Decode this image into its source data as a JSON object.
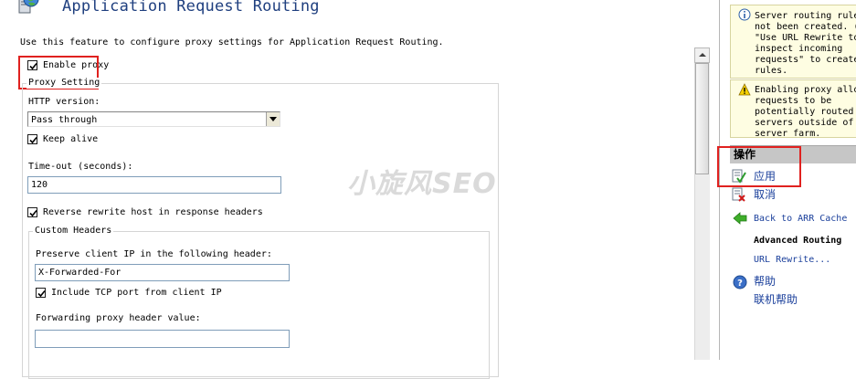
{
  "page": {
    "title": "Application Request Routing",
    "description": "Use this feature to configure proxy settings for Application Request Routing."
  },
  "proxy": {
    "enable_proxy_label": "Enable proxy",
    "enable_proxy_checked": true,
    "group_label": "Proxy Setting",
    "http_version_label": "HTTP version:",
    "http_version_value": "Pass through",
    "keep_alive_label": "Keep alive",
    "keep_alive_checked": true,
    "timeout_label": "Time-out (seconds):",
    "timeout_value": "120",
    "reverse_rewrite_label": "Reverse rewrite host in response headers",
    "reverse_rewrite_checked": true
  },
  "custom_headers": {
    "group_label": "Custom Headers",
    "preserve_ip_label": "Preserve client IP in the following header:",
    "preserve_ip_value": "X-Forwarded-For",
    "include_tcp_label": "Include TCP port from client IP",
    "include_tcp_checked": true,
    "forwarding_header_label": "Forwarding proxy header value:",
    "forwarding_header_value": ""
  },
  "alerts": [
    {
      "type": "info",
      "text": "Server routing rule\nnot been created. (\n\"Use URL Rewrite to\ninspect incoming\nrequests\" to create\nrules."
    },
    {
      "type": "warning",
      "text": "Enabling proxy allo\nrequests to be\npotentially routed\nservers outside of\nserver farm."
    }
  ],
  "actions": {
    "header": "操作",
    "apply": "应用",
    "cancel": "取消",
    "back_to_cache": "Back to ARR Cache",
    "advanced_routing": "Advanced Routing",
    "url_rewrite": "URL Rewrite...",
    "help": "帮助",
    "online_help": "联机帮助"
  },
  "watermark": "小旋风SEO",
  "colors": {
    "highlight": "#e0211f",
    "link": "#1a3f9b",
    "alert_bg": "#fefde2",
    "actions_header_bg": "#c6c6c6"
  },
  "icons": {
    "app": "globe-server-icon",
    "info": "info-icon",
    "warning": "warning-icon",
    "apply": "apply-check-icon",
    "cancel": "cancel-x-icon",
    "back": "back-arrow-icon",
    "help": "help-icon"
  }
}
